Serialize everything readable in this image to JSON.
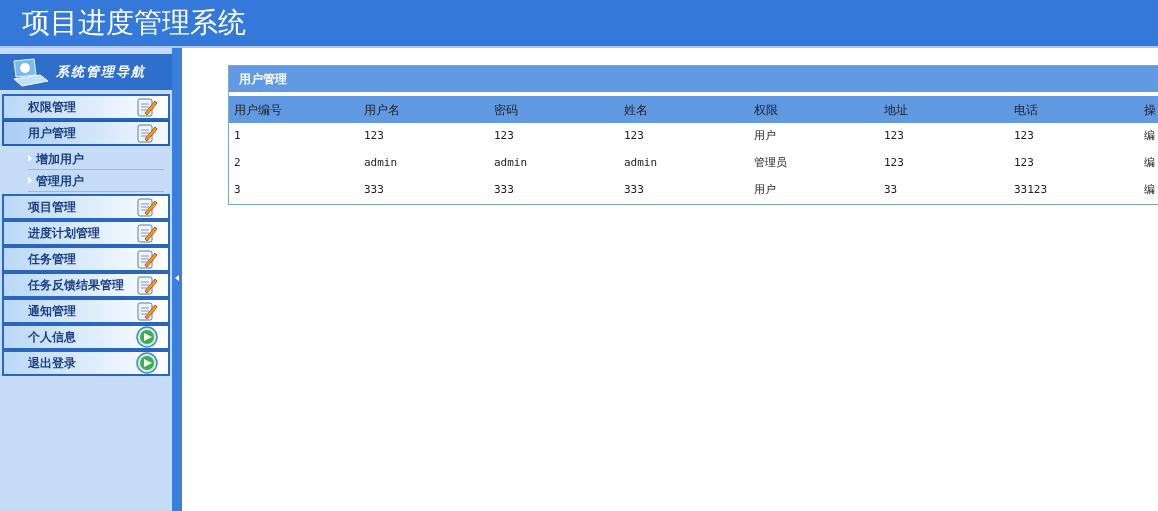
{
  "header": {
    "title": "项目进度管理系统"
  },
  "sidebar": {
    "title": "系统管理导航",
    "items": [
      {
        "label": "权限管理",
        "kind": "edit",
        "expanded": false
      },
      {
        "label": "用户管理",
        "kind": "edit",
        "expanded": true,
        "children": [
          {
            "label": "增加用户"
          },
          {
            "label": "管理用户"
          }
        ]
      },
      {
        "label": "项目管理",
        "kind": "edit",
        "expanded": false
      },
      {
        "label": "进度计划管理",
        "kind": "edit",
        "expanded": false
      },
      {
        "label": "任务管理",
        "kind": "edit",
        "expanded": false
      },
      {
        "label": "任务反馈结果管理",
        "kind": "edit",
        "expanded": false
      },
      {
        "label": "通知管理",
        "kind": "edit",
        "expanded": false
      },
      {
        "label": "个人信息",
        "kind": "go",
        "expanded": false
      },
      {
        "label": "退出登录",
        "kind": "go",
        "expanded": false
      }
    ]
  },
  "panel": {
    "title": "用户管理",
    "table": {
      "columns": [
        "用户编号",
        "用户名",
        "密码",
        "姓名",
        "权限",
        "地址",
        "电话",
        "操"
      ],
      "rows": [
        [
          "1",
          "123",
          "123",
          "123",
          "用户",
          "123",
          "123",
          "编"
        ],
        [
          "2",
          "admin",
          "admin",
          "admin",
          "管理员",
          "123",
          "123",
          "编"
        ],
        [
          "3",
          "333",
          "333",
          "333",
          "用户",
          "33",
          "33123",
          "编"
        ]
      ]
    }
  }
}
